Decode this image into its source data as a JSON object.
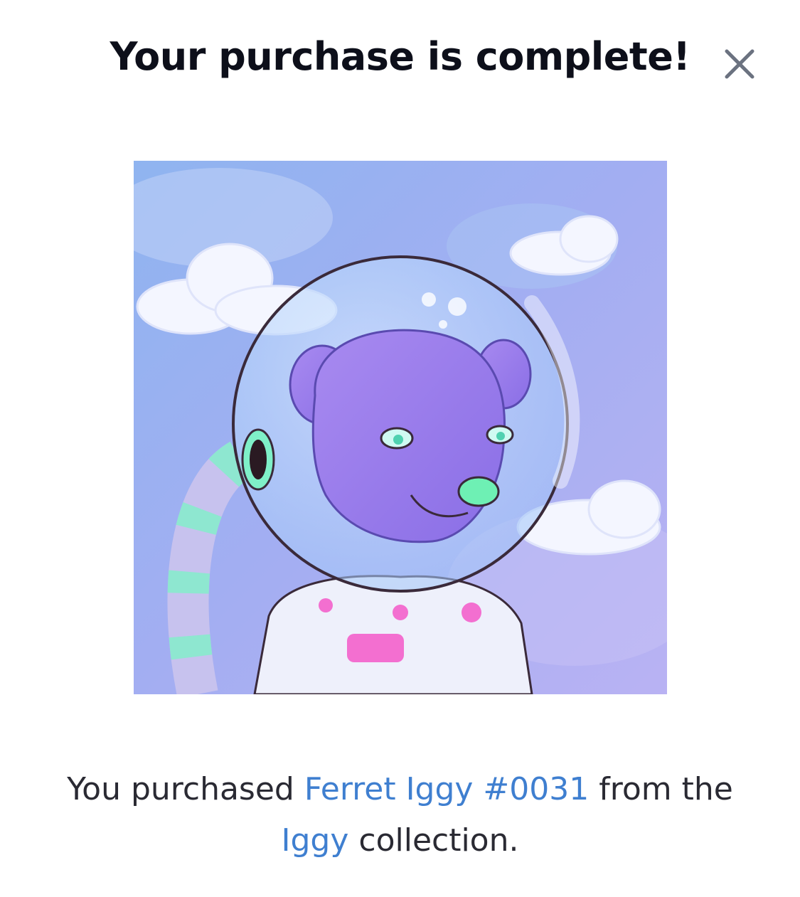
{
  "modal": {
    "title": "Your purchase is complete!",
    "close_icon": "close-icon"
  },
  "nft": {
    "image_description_icon": "nft-artwork-image",
    "name": "Ferret Iggy #0031",
    "collection": "Iggy"
  },
  "message": {
    "prefix": "You purchased ",
    "middle": " from the ",
    "suffix": " collection."
  },
  "colors": {
    "title": "#0d0f1a",
    "text": "#2a2a33",
    "link": "#3f7fd0",
    "close": "#6b7280",
    "background": "#ffffff"
  }
}
